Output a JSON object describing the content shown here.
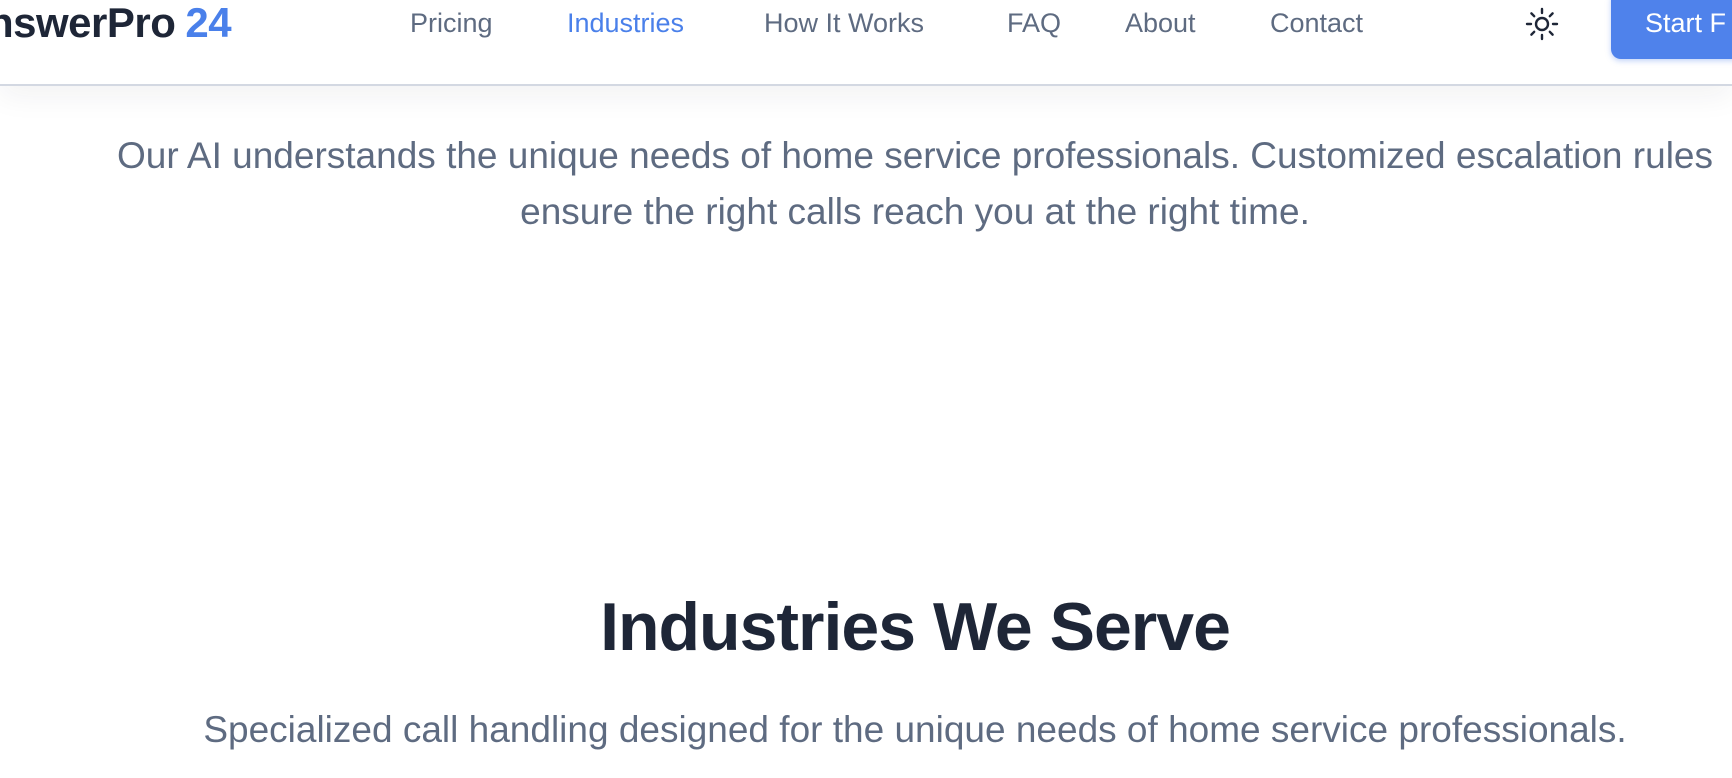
{
  "header": {
    "logo_text": "nswerPro",
    "logo_accent": "24",
    "nav": {
      "pricing": "Pricing",
      "industries": "Industries",
      "how_it_works": "How It Works",
      "faq": "FAQ",
      "about": "About",
      "contact": "Contact"
    },
    "active_nav": "industries",
    "theme_toggle_icon": "sun-icon",
    "cta_label": "Start F"
  },
  "intro": {
    "text": "Our AI understands the unique needs of home service professionals. Customized escalation rules ensure the right calls reach you at the right time."
  },
  "industries_section": {
    "title": "Industries We Serve",
    "subtitle": "Specialized call handling designed for the unique needs of home service professionals."
  },
  "colors": {
    "accent": "#4a80ea",
    "heading": "#1e2637",
    "body_text": "#5e6b81",
    "border": "#d3d8e2"
  }
}
